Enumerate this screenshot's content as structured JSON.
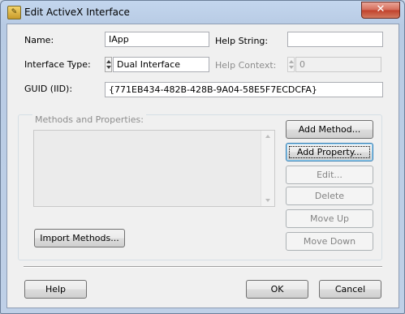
{
  "window": {
    "title": "Edit ActiveX Interface",
    "icon": "activex-app-icon",
    "close_glyph": "✕"
  },
  "form": {
    "name_label": "Name:",
    "name_value": "IApp",
    "help_string_label": "Help String:",
    "help_string_value": "",
    "interface_type_label": "Interface Type:",
    "interface_type_value": "Dual Interface",
    "help_context_label": "Help Context:",
    "help_context_value": "0",
    "guid_label": "GUID (IID):",
    "guid_value": "{771EB434-482B-428B-9A04-58E5F7ECDCFA}"
  },
  "methods": {
    "group_label": "Methods and Properties:",
    "items": [],
    "add_method": "Add Method...",
    "add_property": "Add Property...",
    "edit": "Edit...",
    "delete": "Delete",
    "move_up": "Move Up",
    "move_down": "Move Down",
    "import_methods": "Import Methods..."
  },
  "footer": {
    "help": "Help",
    "ok": "OK",
    "cancel": "Cancel"
  }
}
